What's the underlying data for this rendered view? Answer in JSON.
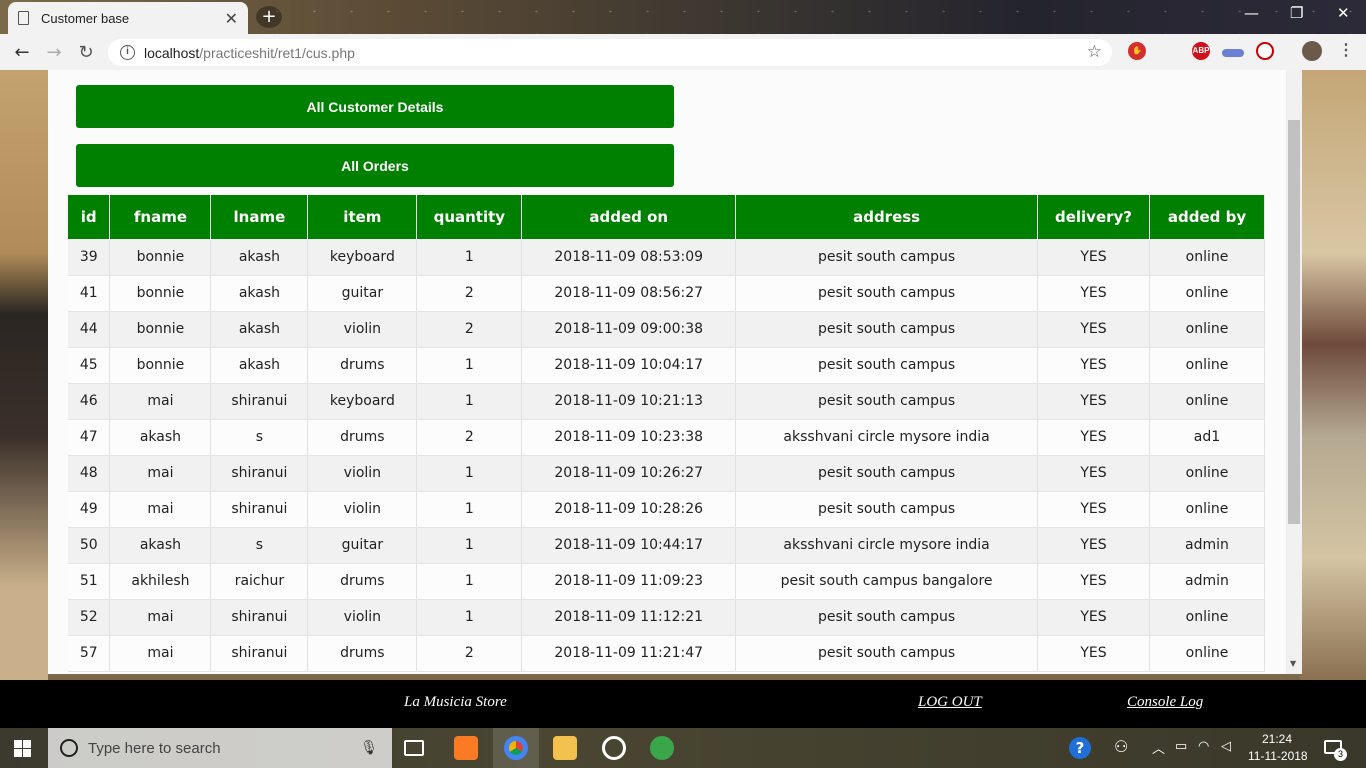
{
  "browser": {
    "tab_title": "Customer base",
    "tab_close": "✕",
    "new_tab": "+",
    "url_host": "localhost",
    "url_path": "/practiceshit/ret1/cus.php",
    "window_controls": [
      "—",
      "❐",
      "✕"
    ],
    "ext_abp": "ABP"
  },
  "actions": {
    "all_customers": "All Customer Details",
    "all_orders": "All Orders"
  },
  "table": {
    "headers": [
      "id",
      "fname",
      "lname",
      "item",
      "quantity",
      "added on",
      "address",
      "delivery?",
      "added by"
    ],
    "rows": [
      [
        "39",
        "bonnie",
        "akash",
        "keyboard",
        "1",
        "2018-11-09 08:53:09",
        "pesit south campus",
        "YES",
        "online"
      ],
      [
        "41",
        "bonnie",
        "akash",
        "guitar",
        "2",
        "2018-11-09 08:56:27",
        "pesit south campus",
        "YES",
        "online"
      ],
      [
        "44",
        "bonnie",
        "akash",
        "violin",
        "2",
        "2018-11-09 09:00:38",
        "pesit south campus",
        "YES",
        "online"
      ],
      [
        "45",
        "bonnie",
        "akash",
        "drums",
        "1",
        "2018-11-09 10:04:17",
        "pesit south campus",
        "YES",
        "online"
      ],
      [
        "46",
        "mai",
        "shiranui",
        "keyboard",
        "1",
        "2018-11-09 10:21:13",
        "pesit south campus",
        "YES",
        "online"
      ],
      [
        "47",
        "akash",
        "s",
        "drums",
        "2",
        "2018-11-09 10:23:38",
        "aksshvani circle mysore india",
        "YES",
        "ad1"
      ],
      [
        "48",
        "mai",
        "shiranui",
        "violin",
        "1",
        "2018-11-09 10:26:27",
        "pesit south campus",
        "YES",
        "online"
      ],
      [
        "49",
        "mai",
        "shiranui",
        "violin",
        "1",
        "2018-11-09 10:28:26",
        "pesit south campus",
        "YES",
        "online"
      ],
      [
        "50",
        "akash",
        "s",
        "guitar",
        "1",
        "2018-11-09 10:44:17",
        "aksshvani circle mysore india",
        "YES",
        "admin"
      ],
      [
        "51",
        "akhilesh",
        "raichur",
        "drums",
        "1",
        "2018-11-09 11:09:23",
        "pesit south campus bangalore",
        "YES",
        "admin"
      ],
      [
        "52",
        "mai",
        "shiranui",
        "violin",
        "1",
        "2018-11-09 11:12:21",
        "pesit south campus",
        "YES",
        "online"
      ],
      [
        "57",
        "mai",
        "shiranui",
        "drums",
        "2",
        "2018-11-09 11:21:47",
        "pesit south campus",
        "YES",
        "online"
      ]
    ]
  },
  "footer": {
    "store": "La Musicia Store",
    "logout": "LOG OUT",
    "console": "Console Log"
  },
  "taskbar": {
    "search_placeholder": "Type here to search",
    "time": "21:24",
    "date": "11-11-2018",
    "notification_count": "3"
  },
  "colors": {
    "accent_green": "#008000"
  }
}
